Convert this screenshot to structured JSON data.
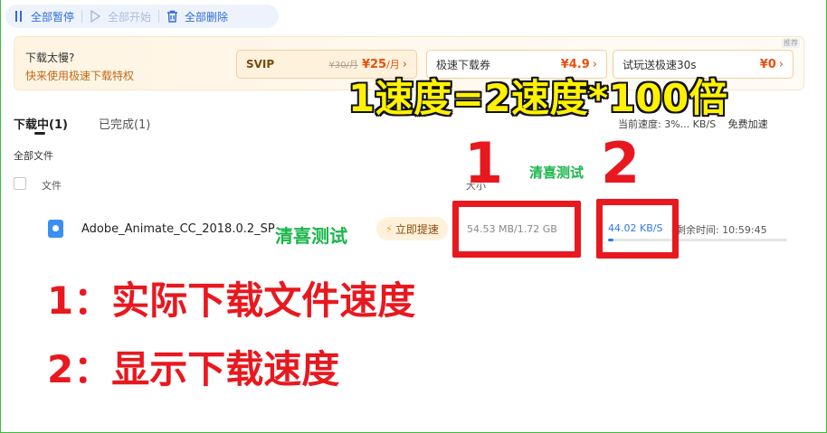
{
  "toolbar": {
    "pause_all": "全部暂停",
    "start_all": "全部开始",
    "delete_all": "全部删除"
  },
  "promo": {
    "title": "下载太慢?",
    "subtitle": "快来使用极速下载特权",
    "recommend_tag": "推荐",
    "cards": [
      {
        "label": "SVIP",
        "old_price": "¥30/月",
        "price": "¥25",
        "unit": "/月"
      },
      {
        "label": "极速下载券",
        "price": "¥4.9"
      },
      {
        "label": "试玩送极速30s",
        "price": "¥0"
      }
    ]
  },
  "tabs": [
    {
      "label": "下载中(1)",
      "active": true
    },
    {
      "label": "已完成(1)",
      "active": false
    }
  ],
  "speed_info": {
    "current_speed": "当前速度: 3%... KB/S",
    "boost_link": "免费加速"
  },
  "breadcrumb": "全部文件",
  "table": {
    "col_file": "文件",
    "col_size": "大小",
    "rows": [
      {
        "name": "Adobe_Animate_CC_2018.0.2_SP",
        "boost_label": "立即提速",
        "size": "54.53 MB/1.72 GB",
        "speed": "44.02 KB/S",
        "remaining_label": "剩余时间: 10:59:45",
        "progress": 0.031
      }
    ]
  },
  "overlay": {
    "headline": "1速度=2速度*100倍",
    "num1": "1",
    "num2": "2",
    "watermark": "清喜测试",
    "note1": "1：实际下载文件速度",
    "note2": "2：显示下载速度"
  },
  "colors": {
    "accent": "#2f7ae5",
    "annotation_red": "#e8181f",
    "headline_yellow": "#fff200",
    "watermark_green": "#19b64a"
  }
}
